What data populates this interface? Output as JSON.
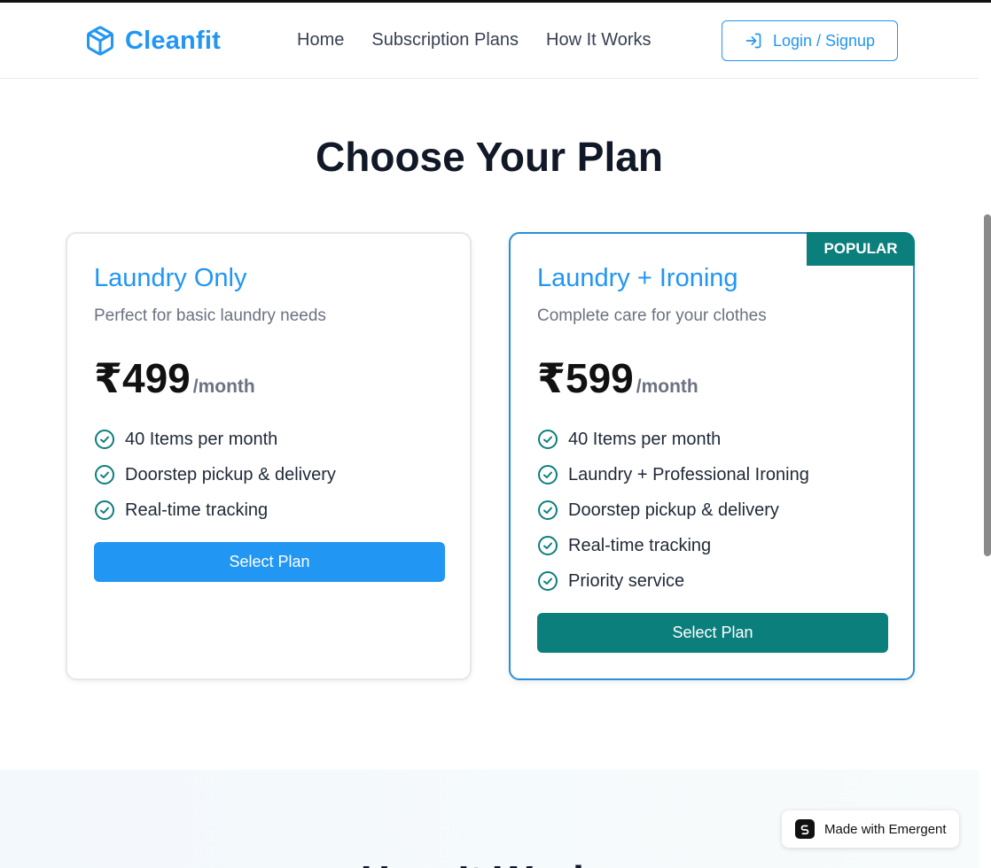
{
  "header": {
    "brand": "Cleanfit",
    "nav": [
      "Home",
      "Subscription Plans",
      "How It Works"
    ],
    "login_label": "Login / Signup"
  },
  "main": {
    "title": "Choose Your Plan",
    "plans": [
      {
        "name": "Laundry Only",
        "description": "Perfect for basic laundry needs",
        "price": "₹499",
        "period": "/month",
        "features": [
          "40 Items per month",
          "Doorstep pickup & delivery",
          "Real-time tracking"
        ],
        "button": "Select Plan"
      },
      {
        "name": "Laundry + Ironing",
        "badge": "POPULAR",
        "description": "Complete care for your clothes",
        "price": "₹599",
        "period": "/month",
        "features": [
          "40 Items per month",
          "Laundry + Professional Ironing",
          "Doorstep pickup & delivery",
          "Real-time tracking",
          "Priority service"
        ],
        "button": "Select Plan"
      }
    ]
  },
  "next_section": {
    "heading": "How It Works"
  },
  "emergent_badge": "Made with Emergent",
  "colors": {
    "brand_blue": "#2196f3",
    "teal": "#0b7f7c",
    "check": "#0b7f7c"
  },
  "icons": {
    "brand": "box-icon",
    "login": "login-icon",
    "feature": "check-circle-icon",
    "emergent": "emergent-logo-icon"
  }
}
